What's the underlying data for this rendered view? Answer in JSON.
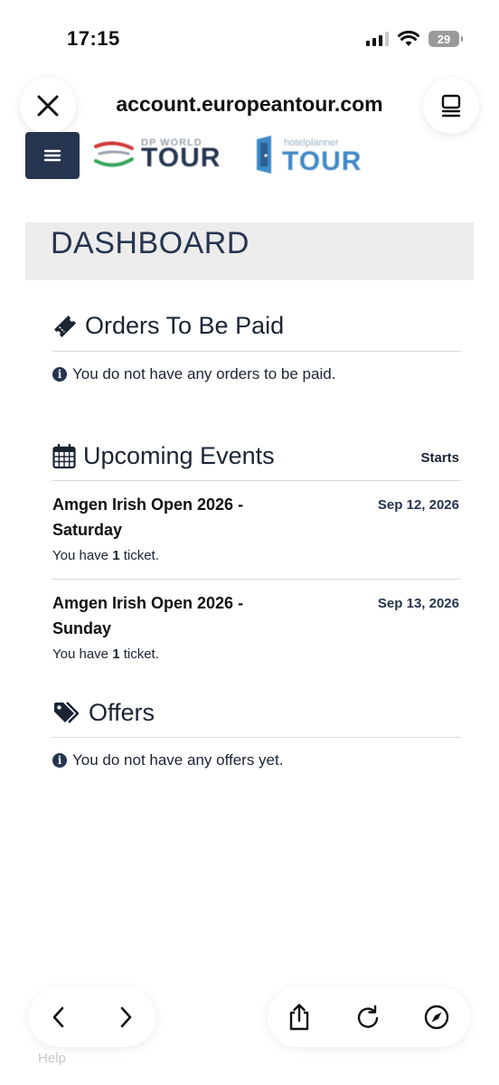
{
  "status_bar": {
    "time": "17:15",
    "battery": "29"
  },
  "browser": {
    "url": "account.europeantour.com"
  },
  "logos": {
    "dp_small": "DP WORLD",
    "dp_big": "TOUR",
    "hb_small": "hotelplanner",
    "hb_big": "TOUR"
  },
  "dashboard": {
    "title": "DASHBOARD"
  },
  "orders": {
    "title": "Orders To Be Paid",
    "message": "You do not have any orders to be paid."
  },
  "upcoming": {
    "title": "Upcoming Events",
    "starts_label": "Starts",
    "events": [
      {
        "name": "Amgen Irish Open 2026 - Saturday",
        "date": "Sep 12, 2026",
        "ticket_prefix": "You have",
        "ticket_count": "1",
        "ticket_suffix": "ticket."
      },
      {
        "name": "Amgen Irish Open 2026 - Sunday",
        "date": "Sep 13, 2026",
        "ticket_prefix": "You have",
        "ticket_count": "1",
        "ticket_suffix": "ticket."
      }
    ]
  },
  "offers": {
    "title": "Offers",
    "message": "You do not have any offers yet."
  },
  "footer": {
    "help": "Help"
  },
  "colors": {
    "navy": "#26354f",
    "dash_bg": "#ececec",
    "hb_blue": "#3f89c7"
  }
}
